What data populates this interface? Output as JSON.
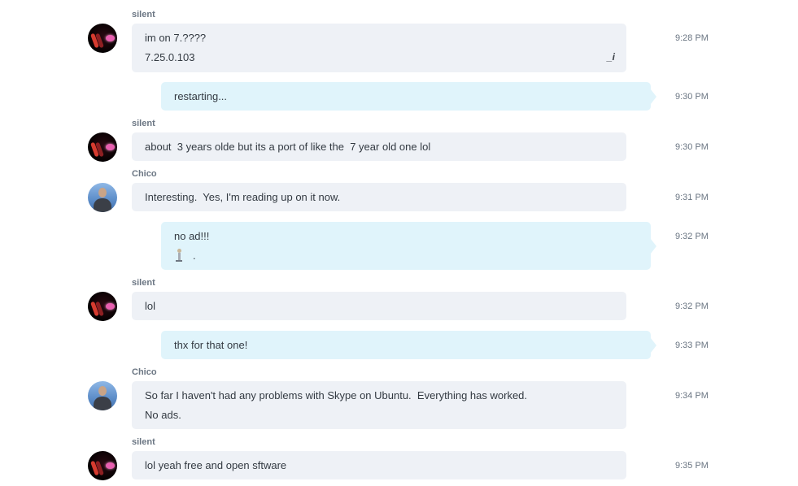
{
  "messages": [
    {
      "sender": "silent",
      "lines": [
        "im on 7.????",
        "7.25.0.103"
      ],
      "time": "9:28 PM",
      "edited_icon": "_i"
    },
    {
      "lines": [
        "restarting..."
      ],
      "time": "9:30 PM"
    },
    {
      "sender": "silent",
      "lines": [
        "about  3 years olde but its a port of like the  7 year old one lol"
      ],
      "time": "9:30 PM"
    },
    {
      "sender": "Chico",
      "lines": [
        "Interesting.  Yes, I'm reading up on it now."
      ],
      "time": "9:31 PM"
    },
    {
      "lines": [
        "no ad!!!",
        "."
      ],
      "time": "9:32 PM",
      "emoticon": "person-emoticon"
    },
    {
      "sender": "silent",
      "lines": [
        "lol"
      ],
      "time": "9:32 PM"
    },
    {
      "lines": [
        "thx for that one!"
      ],
      "time": "9:33 PM"
    },
    {
      "sender": "Chico",
      "lines": [
        "So far I haven't had any problems with Skype on Ubuntu.  Everything has worked.",
        "No ads."
      ],
      "time": "9:34 PM"
    },
    {
      "sender": "silent",
      "lines": [
        "lol yeah free and open sftware"
      ],
      "time": "9:35 PM"
    }
  ],
  "colors": {
    "incoming_bubble": "#eef1f6",
    "outgoing_bubble": "#e0f4fb",
    "meta_text": "#6b7683",
    "message_text": "#333a42"
  }
}
